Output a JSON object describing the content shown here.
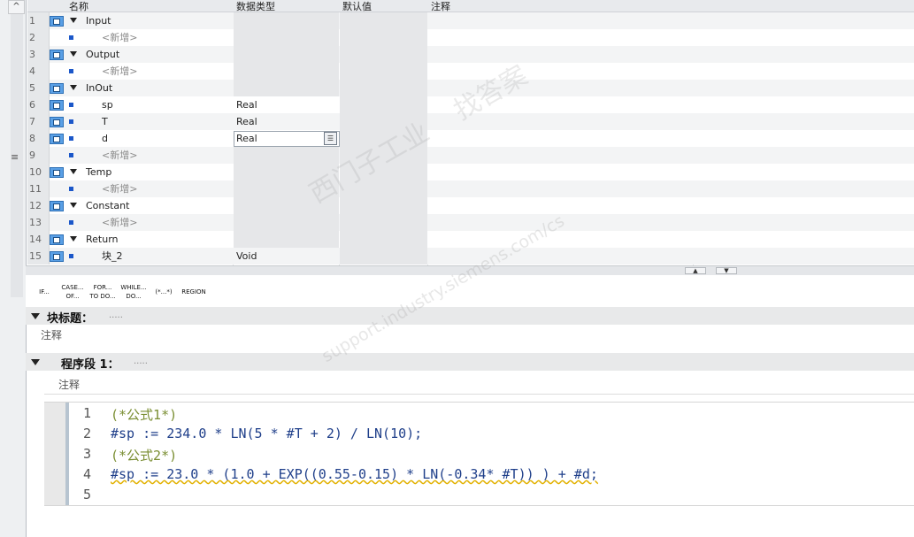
{
  "table": {
    "headers": {
      "name": "名称",
      "datatype": "数据类型",
      "default": "默认值",
      "comment": "注释"
    },
    "rows": [
      {
        "num": "1",
        "kind": "section",
        "name": "Input",
        "type": ""
      },
      {
        "num": "2",
        "kind": "add",
        "name": "<新增>",
        "type": ""
      },
      {
        "num": "3",
        "kind": "section",
        "name": "Output",
        "type": ""
      },
      {
        "num": "4",
        "kind": "add",
        "name": "<新增>",
        "type": ""
      },
      {
        "num": "5",
        "kind": "section",
        "name": "InOut",
        "type": ""
      },
      {
        "num": "6",
        "kind": "var",
        "name": "sp",
        "type": "Real"
      },
      {
        "num": "7",
        "kind": "var",
        "name": "T",
        "type": "Real"
      },
      {
        "num": "8",
        "kind": "var",
        "name": "d",
        "type": "Real",
        "editing": true
      },
      {
        "num": "9",
        "kind": "add",
        "name": "<新增>",
        "type": ""
      },
      {
        "num": "10",
        "kind": "section",
        "name": "Temp",
        "type": ""
      },
      {
        "num": "11",
        "kind": "add",
        "name": "<新增>",
        "type": ""
      },
      {
        "num": "12",
        "kind": "section",
        "name": "Constant",
        "type": ""
      },
      {
        "num": "13",
        "kind": "add",
        "name": "<新增>",
        "type": ""
      },
      {
        "num": "14",
        "kind": "section",
        "name": "Return",
        "type": ""
      },
      {
        "num": "15",
        "kind": "var",
        "name": "块_2",
        "type": "Void"
      }
    ]
  },
  "toolbar": {
    "buttons": [
      {
        "id": "if",
        "lines": [
          "IF..."
        ]
      },
      {
        "id": "case",
        "lines": [
          "CASE...",
          "OF..."
        ]
      },
      {
        "id": "for",
        "lines": [
          "FOR...",
          "TO DO..."
        ]
      },
      {
        "id": "while",
        "lines": [
          "WHILE...",
          "DO..."
        ]
      },
      {
        "id": "comment",
        "lines": [
          "(*...*)"
        ]
      },
      {
        "id": "region",
        "lines": [
          "REGION"
        ]
      }
    ]
  },
  "block": {
    "title": "块标题：",
    "title_placeholder": ".....",
    "comment": "注释"
  },
  "network": {
    "title": "程序段 1：",
    "title_placeholder": ".....",
    "comment": "注释"
  },
  "code": {
    "line_numbers": [
      "1",
      "2",
      "3",
      "4",
      "5"
    ],
    "lines": [
      "(*公式1*)",
      "#sp := 234.0 * LN(5 * #T + 2) / LN(10);",
      "(*公式2*)",
      "#sp := 23.0 * (1.0 + EXP((0.55-0.15) * LN(-0.34* #T)) ) + #d;",
      ""
    ]
  },
  "watermark": {
    "text1": "西门子工业",
    "text2": "support.industry.siemens.com/cs",
    "text3": "找答案"
  }
}
